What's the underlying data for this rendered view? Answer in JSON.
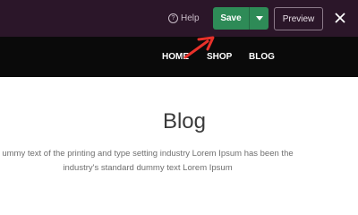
{
  "editor_bar": {
    "help_label": "Help",
    "help_icon": "help-circle-icon",
    "save_label": "Save",
    "save_color": "#2e8b57",
    "dropdown_icon": "caret-down-icon",
    "preview_label": "Preview",
    "close_icon": "close-icon",
    "background": "#2b1629"
  },
  "site_nav": {
    "items": [
      {
        "label": "HOME"
      },
      {
        "label": "SHOP"
      },
      {
        "label": "BLOG"
      }
    ],
    "background": "#0a0a0a"
  },
  "main": {
    "title": "Blog",
    "text_line_1": "ummy text of the printing and type setting industry Lorem Ipsum has been the",
    "text_line_2": "industry's standard dummy text Lorem Ipsum"
  },
  "annotation": {
    "arrow_color": "#e8312a",
    "arrow_icon": "arrow-pointer-icon"
  }
}
